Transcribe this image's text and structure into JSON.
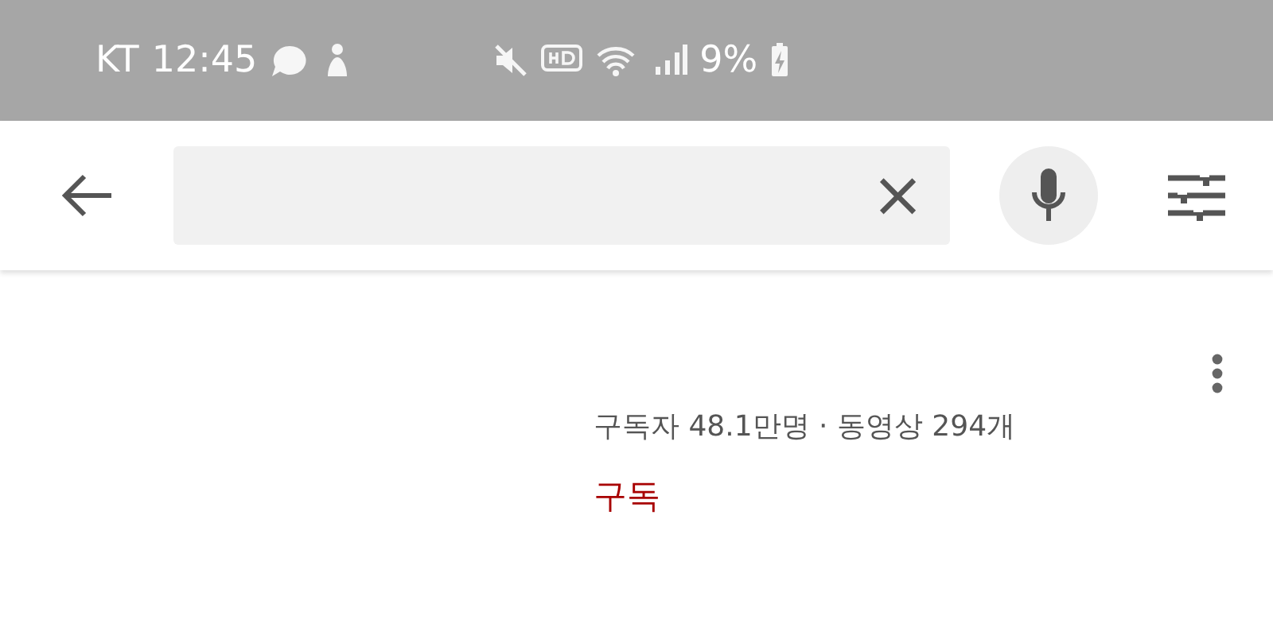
{
  "status_bar": {
    "carrier": "KT",
    "time": "12:45",
    "battery": "9%"
  },
  "search": {
    "clear": "×"
  },
  "channel": {
    "stats": "구독자 48.1만명 · 동영상 294개",
    "subscribe": "구독"
  }
}
